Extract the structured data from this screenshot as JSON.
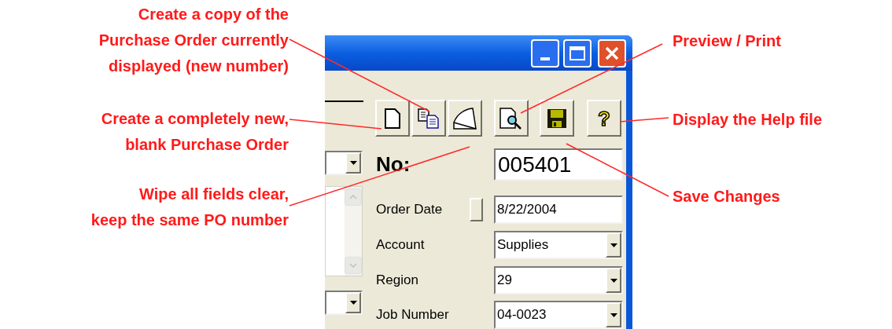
{
  "annotations_left": [
    {
      "lines": [
        "Create a copy of the",
        "Purchase Order currently",
        "displayed (new number)"
      ]
    },
    {
      "lines": [
        "Create a completely new,",
        "blank Purchase Order"
      ]
    },
    {
      "lines": [
        "Wipe all fields clear,",
        "keep the same PO number"
      ]
    }
  ],
  "annotations_right": [
    {
      "lines": [
        "Preview / Print"
      ]
    },
    {
      "lines": [
        "Display the Help file"
      ]
    },
    {
      "lines": [
        "Save Changes"
      ]
    }
  ],
  "toolbar": [
    {
      "kind": "new"
    },
    {
      "kind": "copy"
    },
    {
      "kind": "wipe"
    },
    {
      "kind": "preview"
    },
    {
      "kind": "save"
    },
    {
      "kind": "help",
      "label": "?"
    }
  ],
  "form": {
    "number_label": "No:",
    "number_value": "005401",
    "fields": [
      {
        "kind": "date",
        "label": "Order Date",
        "value": "8/22/2004"
      },
      {
        "kind": "combo",
        "label": "Account",
        "value": "Supplies"
      },
      {
        "kind": "combo",
        "label": "Region",
        "value": "29"
      },
      {
        "kind": "combo",
        "label": "Job Number",
        "value": "04-0023"
      }
    ]
  }
}
